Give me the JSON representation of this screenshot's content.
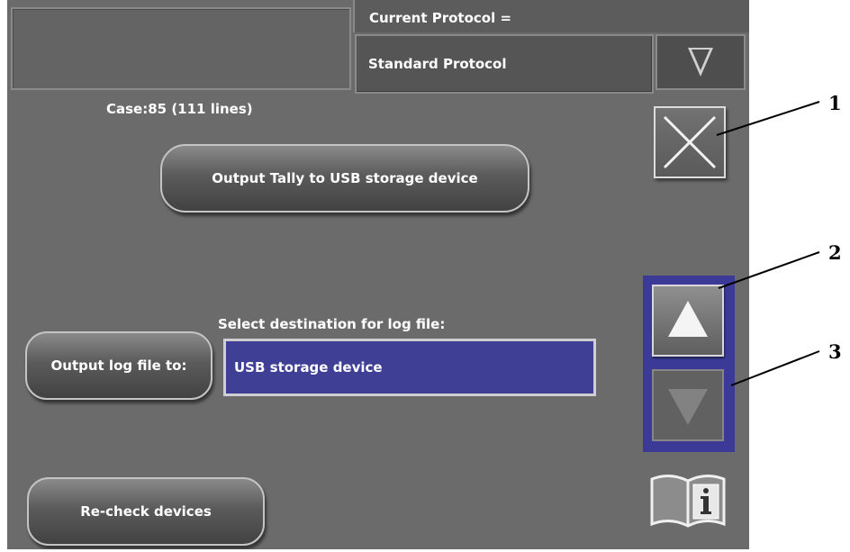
{
  "header": {
    "protocol_title": "Current Protocol =",
    "protocol_value": "Standard Protocol"
  },
  "case_info": "Case:85 (111 lines)",
  "buttons": {
    "output_tally": "Output Tally to USB storage device",
    "output_log": "Output log file to:",
    "recheck": "Re-check devices"
  },
  "log_destination": {
    "label": "Select destination for log file:",
    "value": "USB storage device"
  },
  "callouts": [
    "1",
    "2",
    "3"
  ],
  "icons": {
    "protocol_toggle": "triangle-down-outline-icon",
    "close": "x-close-icon",
    "scroll_up": "triangle-up-icon",
    "scroll_down": "triangle-down-icon",
    "help": "book-info-icon"
  },
  "colors": {
    "background": "#6b6b6b",
    "selection": "#3f3f96",
    "scroll_panel": "#3b3b97",
    "text": "#ffffff"
  }
}
